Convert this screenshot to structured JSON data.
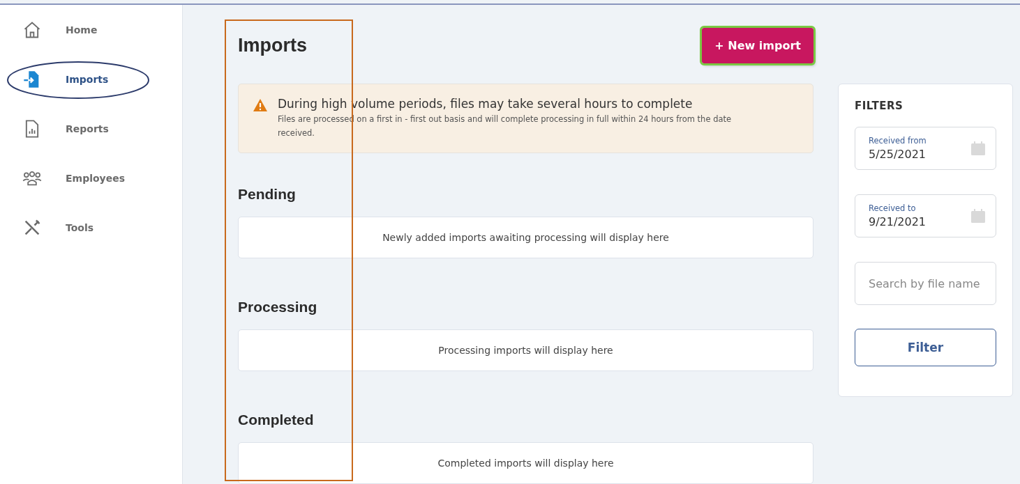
{
  "sidebar": {
    "items": [
      {
        "label": "Home",
        "selected": false
      },
      {
        "label": "Imports",
        "selected": true
      },
      {
        "label": "Reports",
        "selected": false
      },
      {
        "label": "Employees",
        "selected": false
      },
      {
        "label": "Tools",
        "selected": false
      }
    ]
  },
  "page": {
    "title": "Imports",
    "new_button": "+ New import"
  },
  "alert": {
    "title": "During high volume periods, files may take several hours to complete",
    "message": "Files are processed on a first in - first out basis and will complete processing in full within 24 hours from the date received."
  },
  "sections": [
    {
      "title": "Pending",
      "empty_message": "Newly added imports awaiting processing will display here"
    },
    {
      "title": "Processing",
      "empty_message": "Processing imports will display here"
    },
    {
      "title": "Completed",
      "empty_message": "Completed imports will display here"
    }
  ],
  "filters": {
    "title": "FILTERS",
    "fields": [
      {
        "kind": "date",
        "label": "Received from",
        "value": "5/25/2021"
      },
      {
        "kind": "date",
        "label": "Received to",
        "value": "9/21/2021"
      },
      {
        "kind": "search",
        "placeholder": "Search by file name"
      }
    ],
    "button": "Filter"
  }
}
